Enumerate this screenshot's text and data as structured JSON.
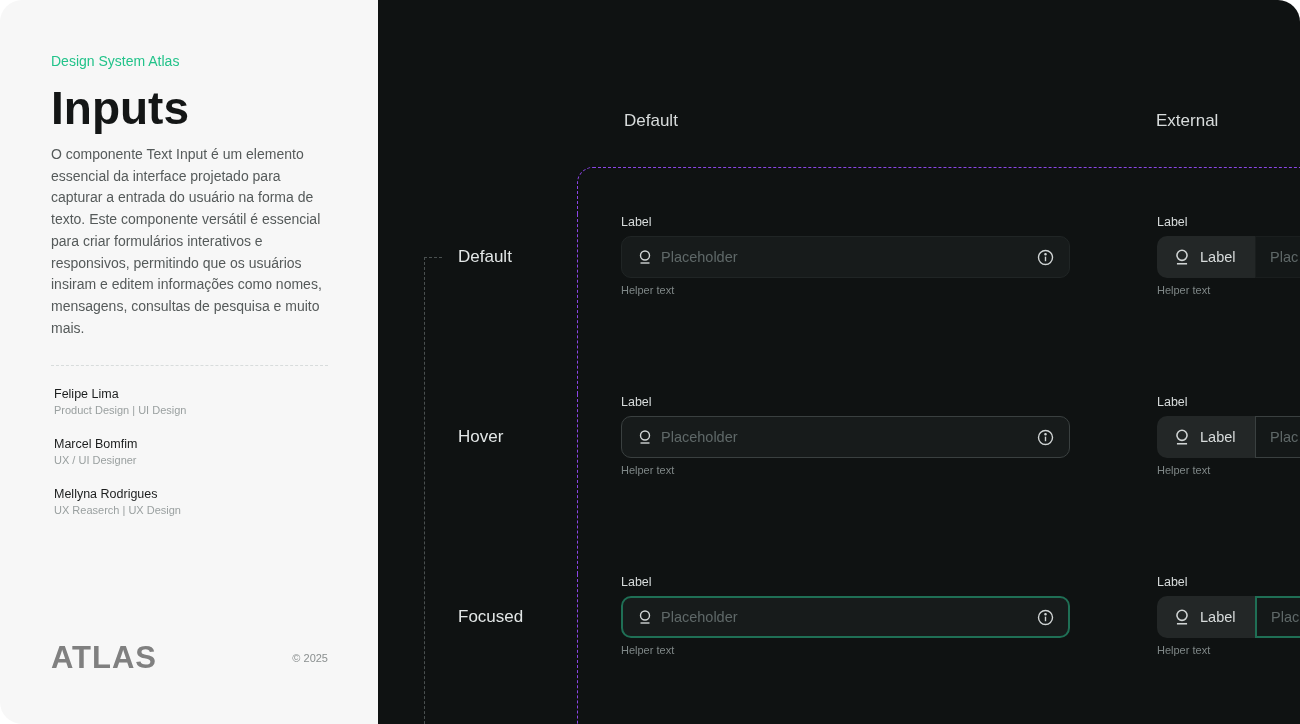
{
  "sidebar": {
    "eyebrow": "Design System Atlas",
    "title": "Inputs",
    "description": "O componente Text Input é um elemento essencial da interface projetado para capturar a entrada do usuário na forma de texto. Este componente versátil é essencial para criar formulários interativos e responsivos, permitindo que os usuários insiram e editem informações como nomes, mensagens, consultas de pesquisa e muito mais.",
    "authors": [
      {
        "name": "Felipe Lima",
        "role": "Product Design | UI Design"
      },
      {
        "name": "Marcel Bomfim",
        "role": "UX / UI Designer"
      },
      {
        "name": "Mellyna Rodrigues",
        "role": "UX Reaserch | UX Design"
      }
    ],
    "logo": "ATLAS",
    "copyright": "© 2025"
  },
  "columns": [
    "Default",
    "External"
  ],
  "rows": [
    {
      "hovered": false,
      "focused": false,
      "label": "Default",
      "fields": [
        {
          "kind": "default",
          "label": "Label",
          "placeholder": "Placeholder",
          "helper": "Helper text"
        },
        {
          "kind": "external",
          "label": "Label",
          "addon": "Label",
          "placeholder": "Plac",
          "helper": "Helper text"
        }
      ]
    },
    {
      "hovered": true,
      "focused": false,
      "label": "Hover",
      "fields": [
        {
          "kind": "default",
          "label": "Label",
          "placeholder": "Placeholder",
          "helper": "Helper text"
        },
        {
          "kind": "external",
          "label": "Label",
          "addon": "Label",
          "placeholder": "Plac",
          "helper": "Helper text"
        }
      ]
    },
    {
      "hovered": false,
      "focused": true,
      "label": "Focused",
      "fields": [
        {
          "kind": "default",
          "label": "Label",
          "placeholder": "Placeholder",
          "helper": "Helper text"
        },
        {
          "kind": "external",
          "label": "Label",
          "addon": "Label",
          "placeholder": "Plac",
          "helper": "Helper text"
        }
      ]
    }
  ]
}
